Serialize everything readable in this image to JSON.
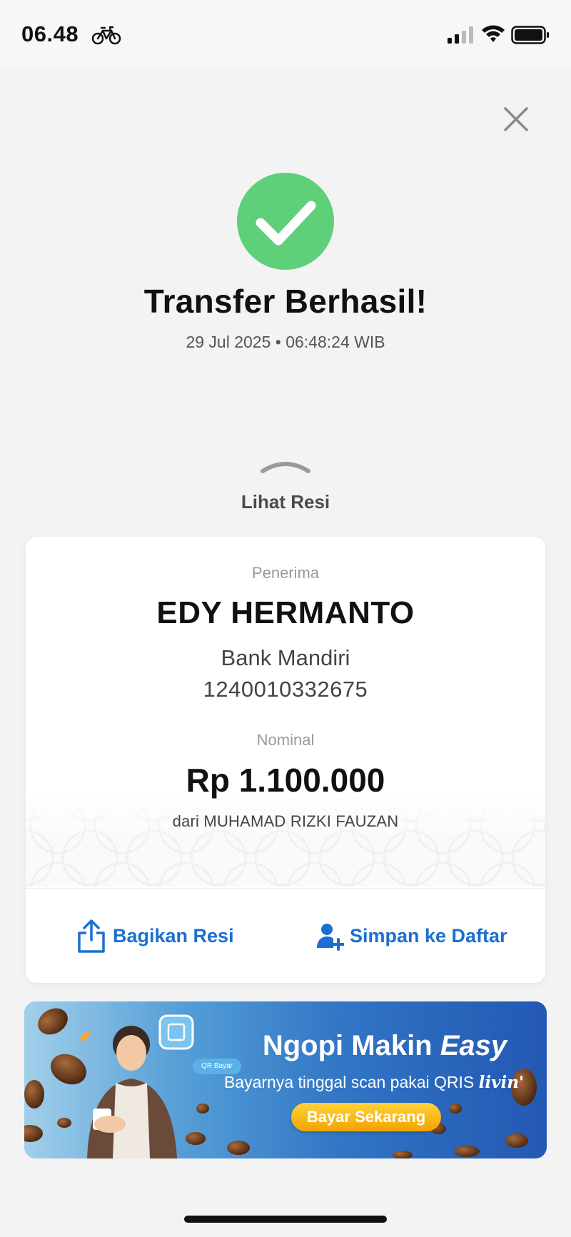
{
  "status_bar": {
    "time": "06.48",
    "icons": [
      "bike-icon",
      "signal-icon",
      "wifi-icon",
      "battery-icon"
    ]
  },
  "header": {
    "close_icon": "close-icon"
  },
  "result": {
    "icon": "check-circle-icon",
    "title": "Transfer Berhasil!",
    "datetime": "29 Jul 2025 • 06:48:24 WIB"
  },
  "receipt_toggle": {
    "icon": "chevron-up-icon",
    "label": "Lihat Resi"
  },
  "receipt": {
    "recipient_label": "Penerima",
    "recipient_name": "EDY HERMANTO",
    "bank": "Bank Mandiri",
    "account_number": "1240010332675",
    "nominal_label": "Nominal",
    "amount": "Rp 1.100.000",
    "sender": "dari MUHAMAD RIZKI FAUZAN"
  },
  "actions": {
    "share_label": "Bagikan Resi",
    "share_icon": "share-icon",
    "save_label": "Simpan ke Daftar",
    "save_icon": "add-user-icon"
  },
  "banner": {
    "headline_main": "Ngopi Makin ",
    "headline_emph": "Easy",
    "subtitle": "Bayarnya tinggal scan pakai QRIS ",
    "brand": "livin'",
    "cta": "Bayar Sekarang",
    "qr_badge": "QR Bayar"
  },
  "colors": {
    "accent": "#1b6fd1",
    "success": "#5fcf7a",
    "background": "#f3f3f4"
  }
}
